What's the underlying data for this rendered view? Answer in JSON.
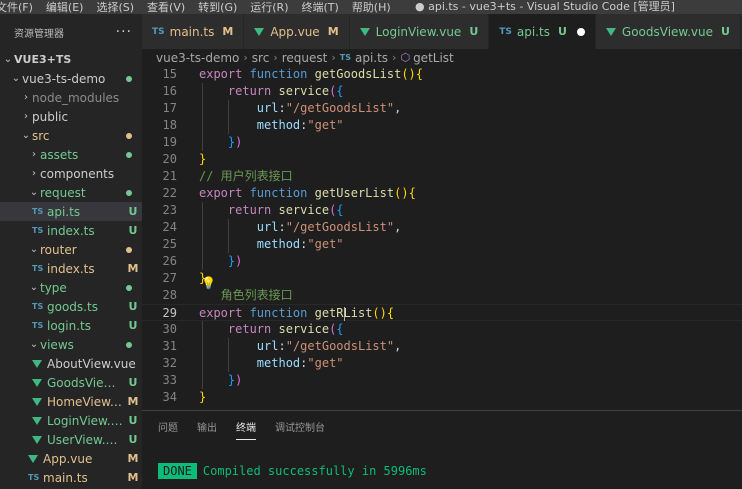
{
  "window": {
    "menu": [
      "文件(F)",
      "编辑(E)",
      "选择(S)",
      "查看(V)",
      "转到(G)",
      "运行(R)",
      "终端(T)",
      "帮助(H)"
    ],
    "title": "● api.ts - vue3+ts - Visual Studio Code [管理员]"
  },
  "sidebar": {
    "header": "资源管理器",
    "more_icon": "···",
    "tree": [
      {
        "depth": 0,
        "chev": "⌄",
        "icon": "",
        "label": "VUE3+TS",
        "badge": "",
        "dot": "",
        "bold": true
      },
      {
        "depth": 1,
        "chev": "⌄",
        "icon": "",
        "label": "vue3-ts-demo",
        "badge": "",
        "dot": "#73c991"
      },
      {
        "depth": 2,
        "chev": "›",
        "icon": "",
        "label": "node_modules",
        "badge": "",
        "dot": "",
        "color": "#8c8c8c"
      },
      {
        "depth": 2,
        "chev": "›",
        "icon": "",
        "label": "public",
        "badge": "",
        "dot": ""
      },
      {
        "depth": 2,
        "chev": "⌄",
        "icon": "",
        "label": "src",
        "badge": "",
        "dot": "#e2c08d",
        "color": "#e2c08d"
      },
      {
        "depth": 3,
        "chev": "›",
        "icon": "",
        "label": "assets",
        "badge": "",
        "dot": "#73c991",
        "color": "#73c991"
      },
      {
        "depth": 3,
        "chev": "›",
        "icon": "",
        "label": "components",
        "badge": "",
        "dot": ""
      },
      {
        "depth": 3,
        "chev": "⌄",
        "icon": "",
        "label": "request",
        "badge": "",
        "dot": "#73c991",
        "color": "#73c991"
      },
      {
        "depth": 4,
        "chev": "",
        "icon": "TS",
        "label": "api.ts",
        "badge": "U",
        "dot": "",
        "color": "#73c991",
        "selected": true
      },
      {
        "depth": 4,
        "chev": "",
        "icon": "TS",
        "label": "index.ts",
        "badge": "U",
        "dot": "",
        "color": "#73c991"
      },
      {
        "depth": 3,
        "chev": "⌄",
        "icon": "",
        "label": "router",
        "badge": "",
        "dot": "#e2c08d",
        "color": "#e2c08d"
      },
      {
        "depth": 4,
        "chev": "",
        "icon": "TS",
        "label": "index.ts",
        "badge": "M",
        "dot": "",
        "color": "#e2c08d"
      },
      {
        "depth": 3,
        "chev": "⌄",
        "icon": "",
        "label": "type",
        "badge": "",
        "dot": "#73c991",
        "color": "#73c991"
      },
      {
        "depth": 4,
        "chev": "",
        "icon": "TS",
        "label": "goods.ts",
        "badge": "U",
        "dot": "",
        "color": "#73c991"
      },
      {
        "depth": 4,
        "chev": "",
        "icon": "TS",
        "label": "login.ts",
        "badge": "U",
        "dot": "",
        "color": "#73c991"
      },
      {
        "depth": 3,
        "chev": "⌄",
        "icon": "",
        "label": "views",
        "badge": "",
        "dot": "#73c991",
        "color": "#73c991"
      },
      {
        "depth": 4,
        "chev": "",
        "icon": "vue",
        "label": "AboutView.vue",
        "badge": "",
        "dot": ""
      },
      {
        "depth": 4,
        "chev": "",
        "icon": "vue",
        "label": "GoodsView....",
        "badge": "U",
        "dot": "",
        "color": "#73c991"
      },
      {
        "depth": 4,
        "chev": "",
        "icon": "vue",
        "label": "HomeView....",
        "badge": "M",
        "dot": "",
        "color": "#e2c08d"
      },
      {
        "depth": 4,
        "chev": "",
        "icon": "vue",
        "label": "LoginView.vue",
        "badge": "U",
        "dot": "",
        "color": "#73c991"
      },
      {
        "depth": 4,
        "chev": "",
        "icon": "vue",
        "label": "UserView.vue",
        "badge": "U",
        "dot": "",
        "color": "#73c991"
      },
      {
        "depth": 3,
        "chev": "",
        "icon": "vue",
        "label": "App.vue",
        "badge": "M",
        "dot": "",
        "color": "#e2c08d"
      },
      {
        "depth": 3,
        "chev": "",
        "icon": "TS",
        "label": "main.ts",
        "badge": "M",
        "dot": "",
        "color": "#e2c08d"
      }
    ]
  },
  "tabs": [
    {
      "icon": "TS",
      "label": "main.ts",
      "state": "M",
      "state_color": "#e2c08d",
      "active": false
    },
    {
      "icon": "vue",
      "label": "App.vue",
      "state": "M",
      "state_color": "#e2c08d",
      "active": false
    },
    {
      "icon": "vue",
      "label": "LoginView.vue",
      "state": "U",
      "state_color": "#73c991",
      "active": false
    },
    {
      "icon": "TS",
      "label": "api.ts",
      "state": "U",
      "state_color": "#73c991",
      "active": true,
      "dirty": true
    },
    {
      "icon": "vue",
      "label": "GoodsView.vue",
      "state": "U",
      "state_color": "#73c991",
      "active": false
    },
    {
      "icon": "TS",
      "label": "",
      "state": "",
      "state_color": "",
      "active": false
    }
  ],
  "breadcrumb": {
    "parts": [
      "vue3-ts-demo",
      "src",
      "request"
    ],
    "file_icon": "TS",
    "file": "api.ts",
    "symbol_icon": "⬡",
    "symbol": "getList"
  },
  "editor": {
    "lines": [
      {
        "n": "15",
        "tokens": [
          [
            "export ",
            "k-purple"
          ],
          [
            "function ",
            "k-blue"
          ],
          [
            "getGoodsList",
            "k-fn"
          ],
          [
            "(",
            "k-gold"
          ],
          [
            ")",
            "k-gold"
          ],
          [
            "{",
            "k-gold"
          ]
        ]
      },
      {
        "n": "16",
        "tokens": [
          [
            "    return ",
            "k-purple"
          ],
          [
            "service",
            "k-fn"
          ],
          [
            "(",
            "k-pink"
          ],
          [
            "{",
            "k-cyan"
          ]
        ]
      },
      {
        "n": "17",
        "tokens": [
          [
            "        url",
            "k-var"
          ],
          [
            ":",
            "k-text"
          ],
          [
            "\"/getGoodsList\"",
            "k-str"
          ],
          [
            ",",
            "k-text"
          ]
        ]
      },
      {
        "n": "18",
        "tokens": [
          [
            "        method",
            "k-var"
          ],
          [
            ":",
            "k-text"
          ],
          [
            "\"get\"",
            "k-str"
          ]
        ]
      },
      {
        "n": "19",
        "tokens": [
          [
            "    ",
            "k-text"
          ],
          [
            "}",
            "k-cyan"
          ],
          [
            ")",
            "k-pink"
          ]
        ]
      },
      {
        "n": "20",
        "tokens": [
          [
            "}",
            "k-gold"
          ]
        ]
      },
      {
        "n": "21",
        "tokens": [
          [
            "// 用户列表接口",
            "k-cmt"
          ]
        ]
      },
      {
        "n": "22",
        "tokens": [
          [
            "export ",
            "k-purple"
          ],
          [
            "function ",
            "k-blue"
          ],
          [
            "getUserList",
            "k-fn"
          ],
          [
            "(",
            "k-gold"
          ],
          [
            ")",
            "k-gold"
          ],
          [
            "{",
            "k-gold"
          ]
        ]
      },
      {
        "n": "23",
        "tokens": [
          [
            "    return ",
            "k-purple"
          ],
          [
            "service",
            "k-fn"
          ],
          [
            "(",
            "k-pink"
          ],
          [
            "{",
            "k-cyan"
          ]
        ]
      },
      {
        "n": "24",
        "tokens": [
          [
            "        url",
            "k-var"
          ],
          [
            ":",
            "k-text"
          ],
          [
            "\"/getGoodsList\"",
            "k-str"
          ],
          [
            ",",
            "k-text"
          ]
        ]
      },
      {
        "n": "25",
        "tokens": [
          [
            "        method",
            "k-var"
          ],
          [
            ":",
            "k-text"
          ],
          [
            "\"get\"",
            "k-str"
          ]
        ]
      },
      {
        "n": "26",
        "tokens": [
          [
            "    ",
            "k-text"
          ],
          [
            "}",
            "k-cyan"
          ],
          [
            ")",
            "k-pink"
          ]
        ]
      },
      {
        "n": "27",
        "tokens": [
          [
            "}",
            "k-gold"
          ]
        ]
      },
      {
        "n": "28",
        "tokens": [
          [
            "   角色列表接口",
            "k-cmt"
          ]
        ]
      },
      {
        "n": "29",
        "tokens": [
          [
            "export ",
            "k-purple"
          ],
          [
            "function ",
            "k-blue"
          ],
          [
            "getR",
            "k-fn"
          ],
          [
            "|",
            "cursor"
          ],
          [
            "List",
            "k-fn"
          ],
          [
            "(",
            "k-gold"
          ],
          [
            ")",
            "k-gold"
          ],
          [
            "{",
            "k-gold"
          ]
        ]
      },
      {
        "n": "30",
        "tokens": [
          [
            "    return ",
            "k-purple"
          ],
          [
            "service",
            "k-fn"
          ],
          [
            "(",
            "k-pink"
          ],
          [
            "{",
            "k-cyan"
          ]
        ]
      },
      {
        "n": "31",
        "tokens": [
          [
            "        url",
            "k-var"
          ],
          [
            ":",
            "k-text"
          ],
          [
            "\"/getGoodsList\"",
            "k-str"
          ],
          [
            ",",
            "k-text"
          ]
        ]
      },
      {
        "n": "32",
        "tokens": [
          [
            "        method",
            "k-var"
          ],
          [
            ":",
            "k-text"
          ],
          [
            "\"get\"",
            "k-str"
          ]
        ]
      },
      {
        "n": "33",
        "tokens": [
          [
            "    ",
            "k-text"
          ],
          [
            "}",
            "k-cyan"
          ],
          [
            ")",
            "k-pink"
          ]
        ]
      },
      {
        "n": "34",
        "tokens": [
          [
            "}",
            "k-gold"
          ]
        ]
      }
    ],
    "current_line": "29",
    "lightbulb_icon": "💡"
  },
  "panel": {
    "tabs": [
      "问题",
      "输出",
      "终端",
      "调试控制台"
    ],
    "active_tab": "终端",
    "terminal": {
      "badge": "DONE",
      "message": "Compiled successfully in 5996ms"
    }
  }
}
